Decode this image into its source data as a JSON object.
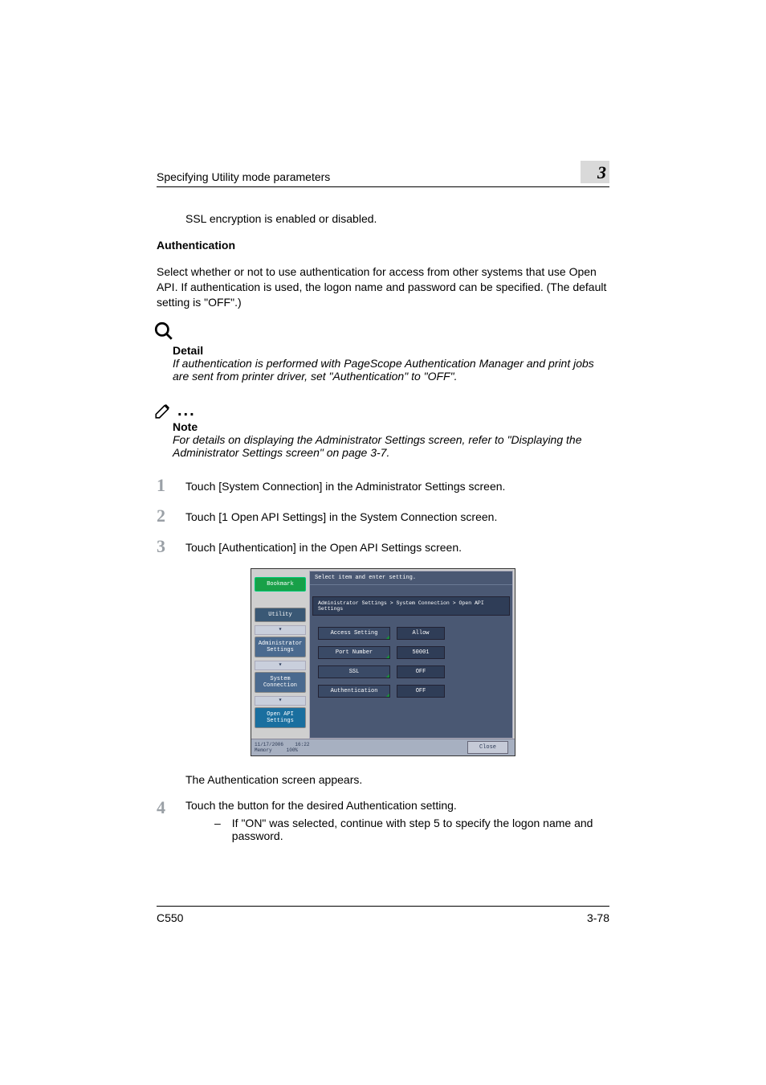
{
  "header": {
    "title": "Specifying Utility mode parameters",
    "chapter": "3"
  },
  "intro": "SSL encryption is enabled or disabled.",
  "section": {
    "heading": "Authentication",
    "para": "Select whether or not to use authentication for access from other systems that use Open API. If authentication is used, the logon name and password can be specified. (The default setting is \"OFF\".)"
  },
  "detail": {
    "label": "Detail",
    "text": "If authentication is performed with PageScope Authentication Manager and print jobs are sent from printer driver, set \"Authentication\" to \"OFF\"."
  },
  "note": {
    "label": "Note",
    "text": "For details on displaying the Administrator Settings screen, refer to \"Displaying the Administrator Settings screen\" on page 3-7."
  },
  "steps": {
    "s1": {
      "num": "1",
      "text": "Touch [System Connection] in the Administrator Settings screen."
    },
    "s2": {
      "num": "2",
      "text": "Touch [1 Open API Settings] in the System Connection screen."
    },
    "s3": {
      "num": "3",
      "text": "Touch [Authentication] in the Open API Settings screen."
    },
    "s4": {
      "num": "4",
      "text": "Touch the button for the desired Authentication setting.",
      "sub": "If \"ON\" was selected, continue with step 5 to specify the logon name and password."
    }
  },
  "after_ss": "The Authentication screen appears.",
  "screenshot": {
    "instruct": "Select item and enter setting.",
    "breadcrumb": "Administrator Settings > System Connection > Open API Settings",
    "nav": {
      "bookmark": "Bookmark",
      "utility": "Utility",
      "admin": "Administrator Settings",
      "sys": "System Connection",
      "api": "Open API Settings"
    },
    "rows": {
      "r1": {
        "label": "Access Setting",
        "value": "Allow"
      },
      "r2": {
        "label": "Port Number",
        "value": "50001"
      },
      "r3": {
        "label": "SSL",
        "value": "OFF"
      },
      "r4": {
        "label": "Authentication",
        "value": "OFF"
      }
    },
    "status": {
      "date": "11/17/2006",
      "time": "16:22",
      "mem_label": "Memory",
      "mem_value": "100%"
    },
    "close": "Close"
  },
  "footer": {
    "model": "C550",
    "page": "3-78"
  }
}
